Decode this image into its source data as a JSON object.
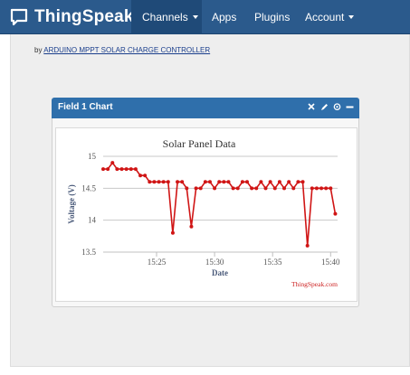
{
  "navbar": {
    "brand": "ThingSpeak",
    "items": [
      {
        "label": "Channels",
        "dropdown": true,
        "active": true
      },
      {
        "label": "Apps",
        "dropdown": false,
        "active": false
      },
      {
        "label": "Plugins",
        "dropdown": false,
        "active": false
      },
      {
        "label": "Account",
        "dropdown": true,
        "active": false
      }
    ]
  },
  "byline": {
    "prefix": "by",
    "link": "ARDUINO MPPT SOLAR CHARGE CONTROLLER"
  },
  "panel": {
    "title": "Field 1 Chart",
    "tools": [
      "close-icon",
      "edit-icon",
      "comment-icon",
      "minimize-icon"
    ]
  },
  "colors": {
    "navbar": "#2b5a8c",
    "panel_header": "#2f6fab",
    "series": "#d01515",
    "credit": "#cc2020"
  },
  "chart_data": {
    "type": "line",
    "title": "Solar Panel Data",
    "xlabel": "Date",
    "ylabel": "Voltage (V)",
    "credit": "ThingSpeak.com",
    "ylim": [
      13.5,
      15
    ],
    "yticks": [
      15,
      14.5,
      14,
      13.5
    ],
    "ytick_labels": [
      "15",
      "14.5",
      "14",
      "13.5"
    ],
    "xlim": [
      "15:20:24",
      "15:40:36"
    ],
    "xticks": [
      "15:25",
      "15:30",
      "15:35",
      "15:40"
    ],
    "grid": true,
    "series": [
      {
        "color": "#d01515",
        "x": [
          "15:20:24",
          "15:20:48",
          "15:21:12",
          "15:21:36",
          "15:22:00",
          "15:22:24",
          "15:22:48",
          "15:23:12",
          "15:23:36",
          "15:24:00",
          "15:24:24",
          "15:24:48",
          "15:25:12",
          "15:25:36",
          "15:26:00",
          "15:26:24",
          "15:26:48",
          "15:27:12",
          "15:27:36",
          "15:28:00",
          "15:28:24",
          "15:28:48",
          "15:29:12",
          "15:29:36",
          "15:30:00",
          "15:30:24",
          "15:30:48",
          "15:31:12",
          "15:31:36",
          "15:32:00",
          "15:32:24",
          "15:32:48",
          "15:33:12",
          "15:33:36",
          "15:34:00",
          "15:34:24",
          "15:34:48",
          "15:35:12",
          "15:35:36",
          "15:36:00",
          "15:36:24",
          "15:36:48",
          "15:37:12",
          "15:37:36",
          "15:38:00",
          "15:38:24",
          "15:38:48",
          "15:39:12",
          "15:39:36",
          "15:40:00",
          "15:40:24"
        ],
        "y": [
          14.8,
          14.8,
          14.9,
          14.8,
          14.8,
          14.8,
          14.8,
          14.8,
          14.7,
          14.7,
          14.6,
          14.6,
          14.6,
          14.6,
          14.6,
          13.8,
          14.6,
          14.6,
          14.5,
          13.9,
          14.5,
          14.5,
          14.6,
          14.6,
          14.5,
          14.6,
          14.6,
          14.6,
          14.5,
          14.5,
          14.6,
          14.6,
          14.5,
          14.5,
          14.6,
          14.5,
          14.6,
          14.5,
          14.6,
          14.5,
          14.6,
          14.5,
          14.6,
          14.6,
          13.6,
          14.5,
          14.5,
          14.5,
          14.5,
          14.5,
          14.1
        ]
      }
    ]
  }
}
